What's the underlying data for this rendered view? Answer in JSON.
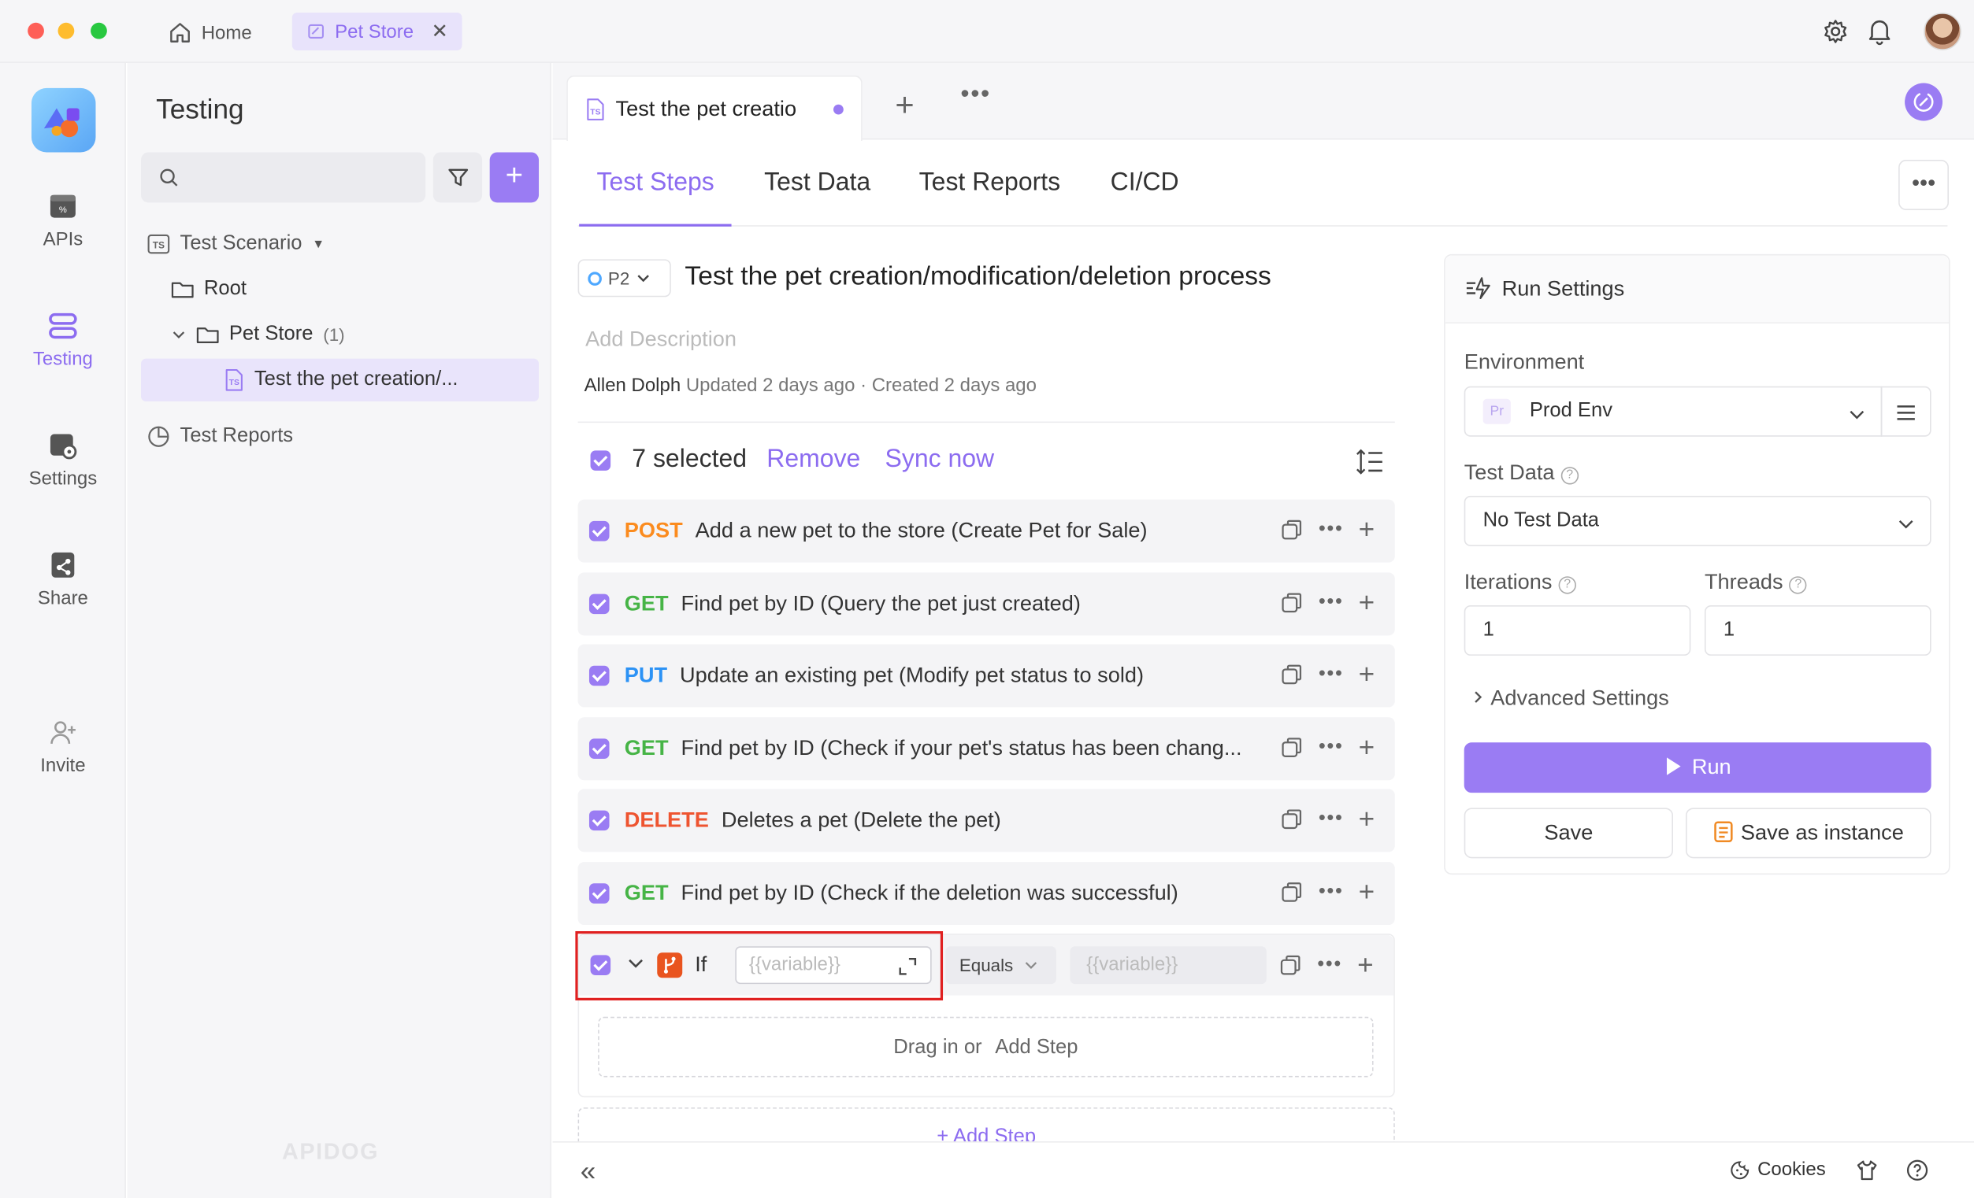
{
  "window": {
    "home_tab": "Home",
    "app_tab": "Pet Store"
  },
  "rail": {
    "items": [
      {
        "label": "APIs",
        "icon": "apis-icon"
      },
      {
        "label": "Testing",
        "icon": "testing-icon",
        "active": true
      },
      {
        "label": "Settings",
        "icon": "settings-icon"
      },
      {
        "label": "Share",
        "icon": "share-icon"
      },
      {
        "label": "Invite",
        "icon": "invite-icon"
      }
    ]
  },
  "sidebar": {
    "title": "Testing",
    "search_placeholder": "",
    "tree": {
      "scenario_label": "Test Scenario",
      "root_label": "Root",
      "folder_label": "Pet Store",
      "folder_count": "(1)",
      "case_label": "Test the pet creation/...",
      "reports_label": "Test Reports"
    },
    "watermark": "APIDOG"
  },
  "main": {
    "doc_tab_label": "Test the pet creatio",
    "sub_tabs": [
      "Test Steps",
      "Test Data",
      "Test Reports",
      "CI/CD"
    ],
    "priority": "P2",
    "case_title": "Test the pet creation/modification/deletion process",
    "description_placeholder": "Add Description",
    "author": "Allen Dolph",
    "meta_text": "Updated 2 days ago · Created 2 days ago",
    "selection": {
      "count_text": "7 selected",
      "remove_label": "Remove",
      "sync_label": "Sync now"
    },
    "steps": [
      {
        "method": "POST",
        "text": "Add a new pet to the store (Create Pet for Sale)"
      },
      {
        "method": "GET",
        "text": "Find pet by ID (Query the pet just created)"
      },
      {
        "method": "PUT",
        "text": "Update an existing pet (Modify pet status to sold)"
      },
      {
        "method": "GET",
        "text": "Find pet by ID (Check if your pet's status has been chang..."
      },
      {
        "method": "DELETE",
        "text": "Deletes a pet (Delete the pet)"
      },
      {
        "method": "GET",
        "text": "Find pet by ID (Check if the deletion was successful)"
      }
    ],
    "if_step": {
      "label": "If",
      "left_placeholder": "{{variable}}",
      "operator": "Equals",
      "right_placeholder": "{{variable}}",
      "drag_text": "Drag in or",
      "drag_add": "Add Step"
    },
    "add_step_label": "+ Add Step"
  },
  "run_settings": {
    "title": "Run Settings",
    "environment_label": "Environment",
    "environment_badge": "Pr",
    "environment_value": "Prod Env",
    "test_data_label": "Test Data",
    "test_data_value": "No Test Data",
    "iterations_label": "Iterations",
    "iterations_value": "1",
    "threads_label": "Threads",
    "threads_value": "1",
    "advanced_label": "Advanced Settings",
    "run_label": "Run",
    "save_label": "Save",
    "save_instance_label": "Save as instance"
  },
  "bottom": {
    "collapse_label": "«",
    "cookies_label": "Cookies"
  },
  "colors": {
    "accent": "#9a7cf3",
    "post": "#fb8b1e",
    "get": "#46b446",
    "put": "#2c92f5",
    "delete": "#ee5430",
    "highlight_border": "#e02020"
  }
}
